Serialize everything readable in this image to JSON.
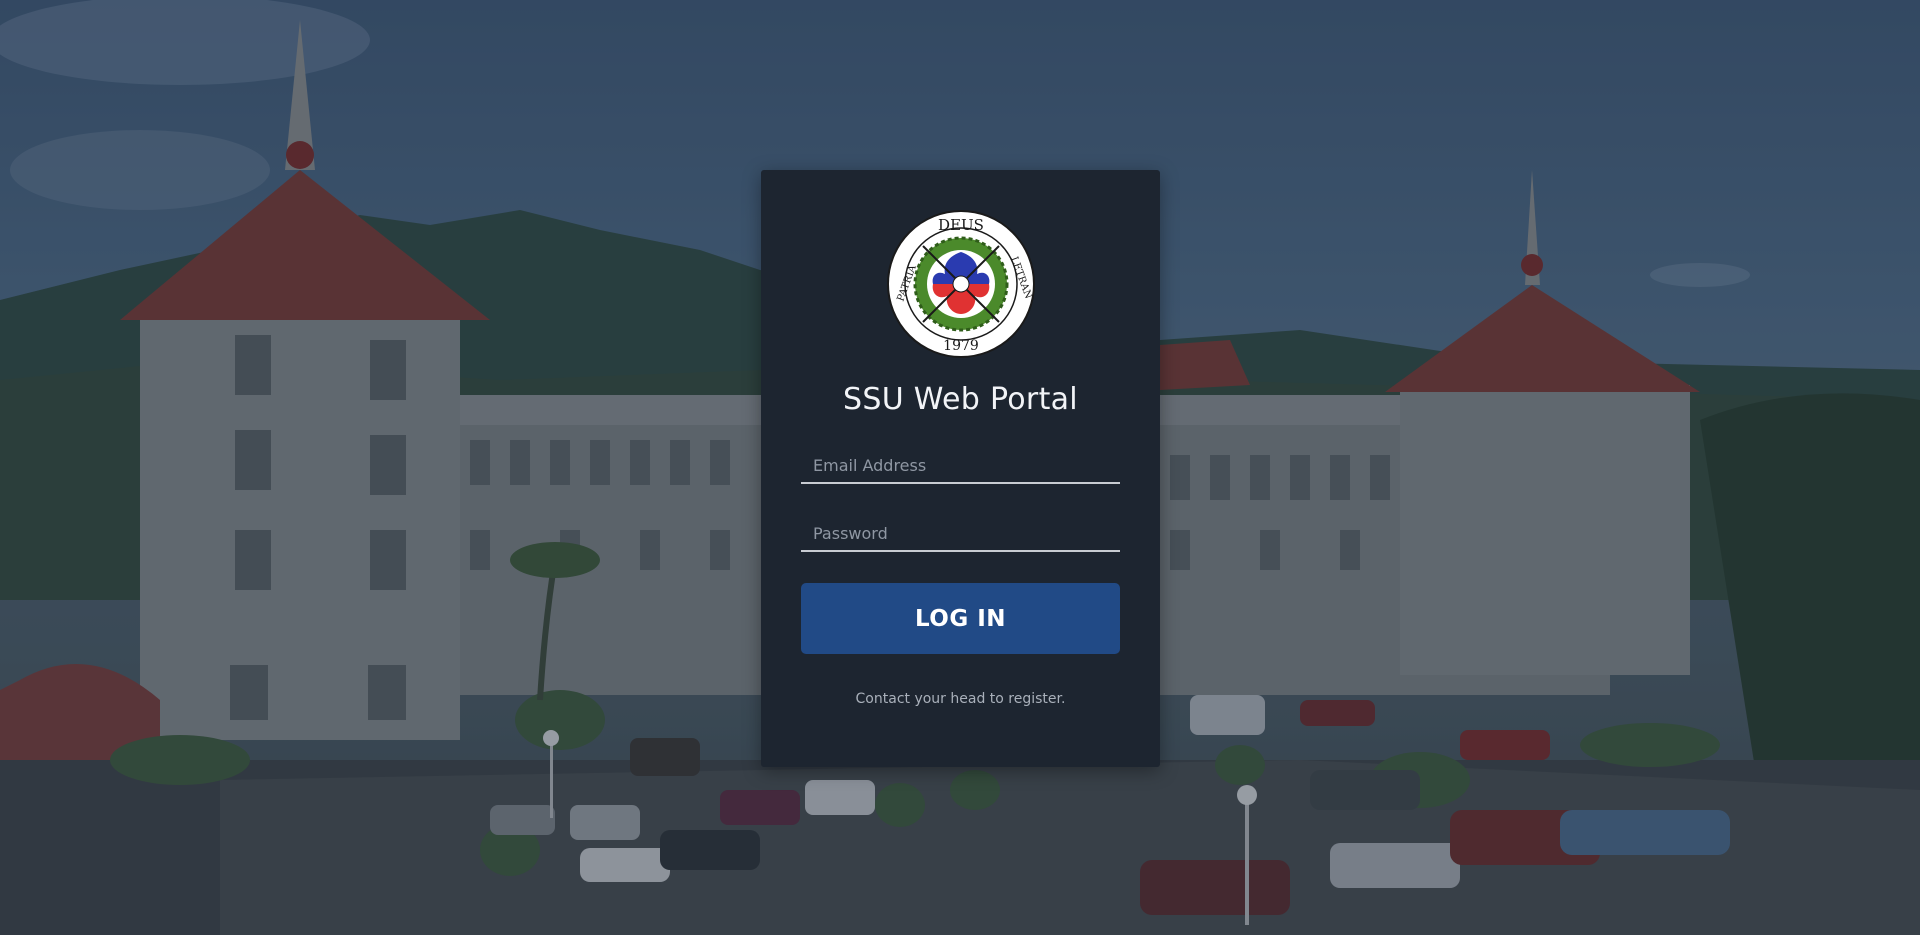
{
  "page": {
    "title": "SSU Web Portal"
  },
  "logo": {
    "motto_top": "DEUS",
    "motto_left": "PATRIA",
    "motto_right": "LETRAN",
    "year": "1979",
    "icon": "seal-logo"
  },
  "form": {
    "email_placeholder": "Email Address",
    "email_value": "",
    "password_placeholder": "Password",
    "password_value": "",
    "login_label": "LOG IN",
    "register_note": "Contact your head to register."
  },
  "colors": {
    "card_bg": "#1d2530",
    "button_bg": "#214a86",
    "underline": "#c8ccd2",
    "title_text": "#f2f4f7"
  }
}
